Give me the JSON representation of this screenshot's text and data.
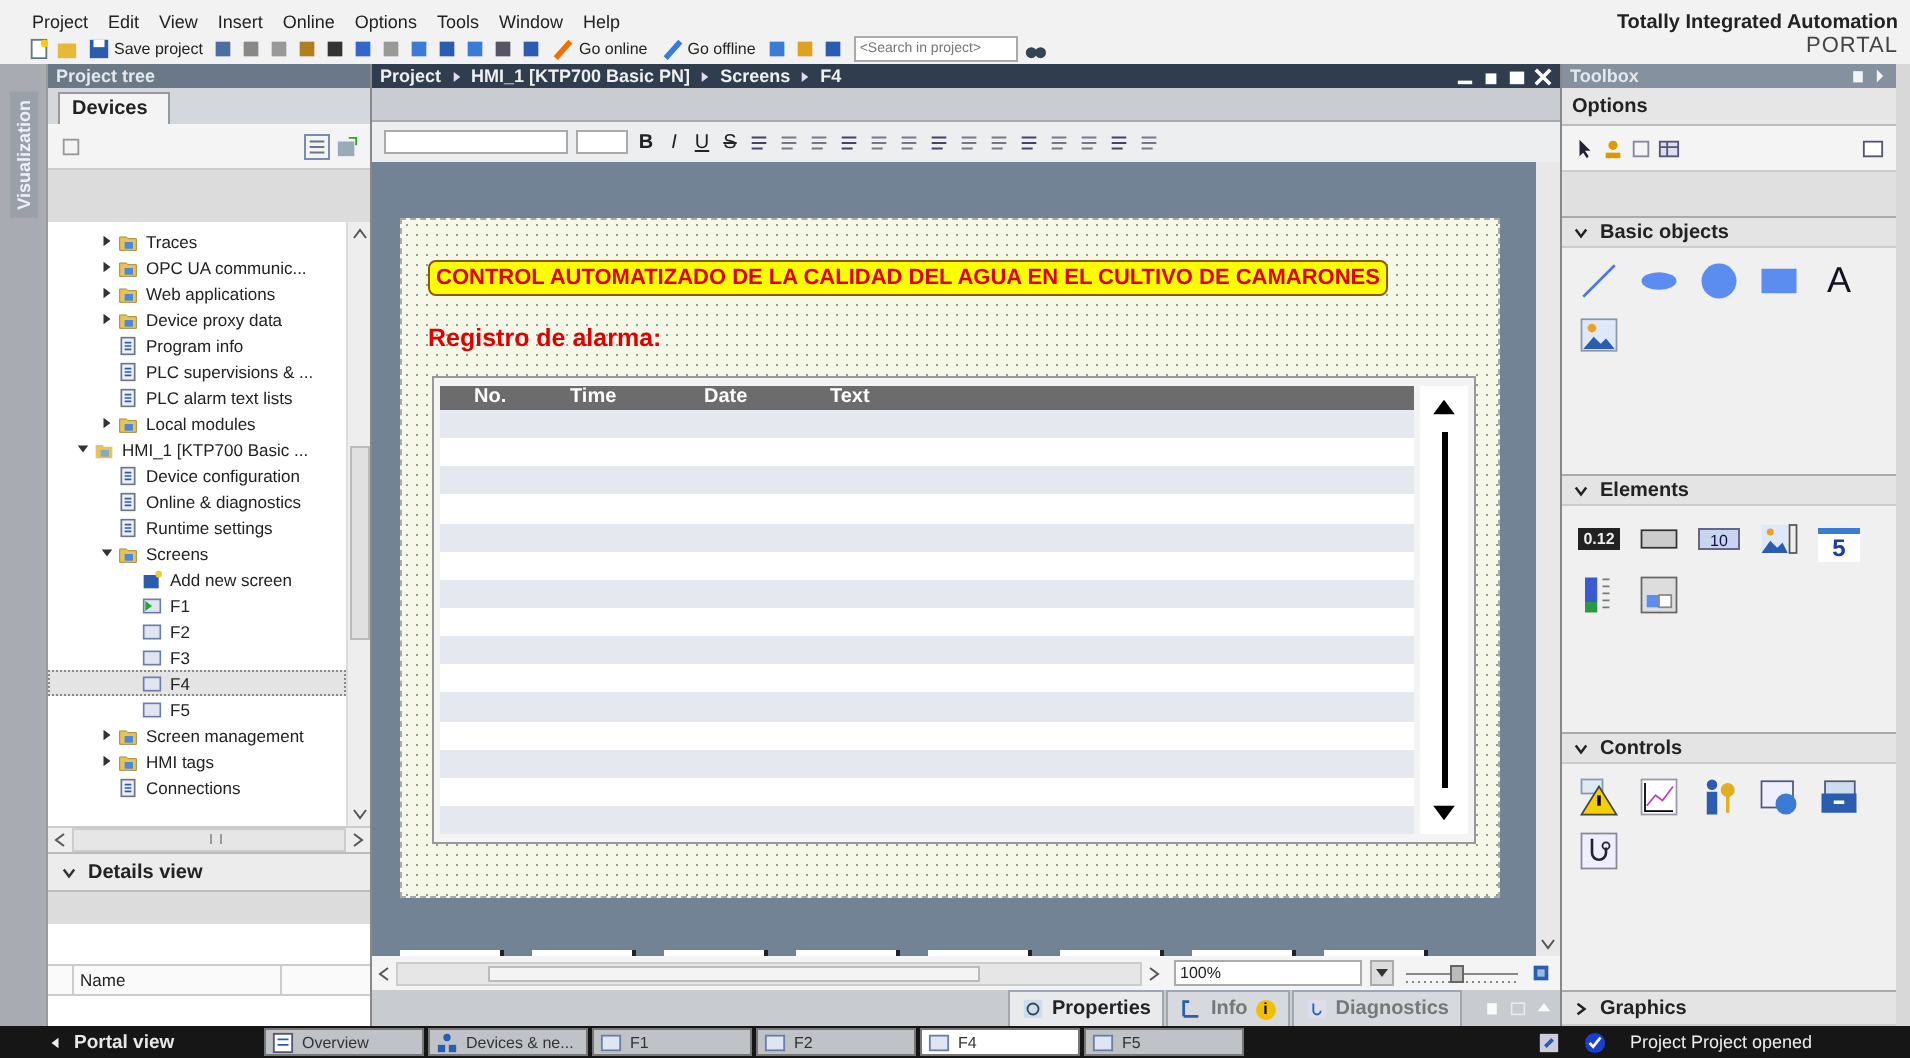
{
  "menu": [
    "Project",
    "Edit",
    "View",
    "Insert",
    "Online",
    "Options",
    "Tools",
    "Window",
    "Help"
  ],
  "toolbar": {
    "save": "Save project",
    "go_online": "Go online",
    "go_offline": "Go offline",
    "search_placeholder": "<Search in project>"
  },
  "brand": {
    "title": "Totally Integrated Automation",
    "subtitle": "PORTAL"
  },
  "side_tab": "Visualization",
  "project_tree": {
    "title": "Project tree",
    "tab": "Devices",
    "continued_children": [
      {
        "label": "Traces",
        "kind": "folder",
        "expanded": false,
        "selected": false
      },
      {
        "label": "OPC UA communic...",
        "kind": "folder",
        "expanded": false,
        "selected": false
      },
      {
        "label": "Web applications",
        "kind": "folder",
        "expanded": false,
        "selected": false
      },
      {
        "label": "Device proxy data",
        "kind": "folder",
        "expanded": false,
        "selected": false
      },
      {
        "label": "Program info",
        "kind": "item",
        "selected": false
      },
      {
        "label": "PLC supervisions & ...",
        "kind": "item",
        "selected": false
      },
      {
        "label": "PLC alarm text lists",
        "kind": "item",
        "selected": false
      },
      {
        "label": "Local modules",
        "kind": "folder",
        "expanded": false,
        "selected": false
      }
    ],
    "items": [
      {
        "label": "HMI_1 [KTP700 Basic ...",
        "kind": "device",
        "expanded": true,
        "selected": false,
        "children": [
          {
            "label": "Device configuration",
            "kind": "item",
            "selected": false
          },
          {
            "label": "Online & diagnostics",
            "kind": "item",
            "selected": false
          },
          {
            "label": "Runtime settings",
            "kind": "item",
            "selected": false
          },
          {
            "label": "Screens",
            "kind": "folder",
            "expanded": true,
            "selected": false,
            "children": [
              {
                "label": "Add new screen",
                "kind": "add",
                "selected": false
              },
              {
                "label": "F1",
                "kind": "start_screen",
                "selected": false
              },
              {
                "label": "F2",
                "kind": "screen",
                "selected": false
              },
              {
                "label": "F3",
                "kind": "screen",
                "selected": false
              },
              {
                "label": "F4",
                "kind": "screen",
                "selected": true
              },
              {
                "label": "F5",
                "kind": "screen",
                "selected": false
              }
            ]
          },
          {
            "label": "Screen management",
            "kind": "folder",
            "expanded": false,
            "selected": false
          },
          {
            "label": "HMI tags",
            "kind": "folder",
            "expanded": false,
            "selected": false
          },
          {
            "label": "Connections",
            "kind": "item",
            "selected": false
          }
        ]
      }
    ]
  },
  "details_view": {
    "title": "Details view",
    "expanded": true,
    "columns": [
      "Name"
    ]
  },
  "editor": {
    "breadcrumb": [
      "Project",
      "HMI_1 [KTP700 Basic PN]",
      "Screens",
      "F4"
    ],
    "format_buttons": [
      "B",
      "I",
      "U",
      "S"
    ],
    "screen": {
      "title": "CONTROL AUTOMATIZADO DE LA CALIDAD DEL AGUA EN EL CULTIVO DE CAMARONES",
      "subtitle": "Registro de alarma:",
      "alarm_view": {
        "columns": [
          "No.",
          "Time",
          "Date",
          "Text"
        ]
      }
    },
    "zoom": "100%",
    "zoom_slider": {
      "level": 0.45
    }
  },
  "inspector_tabs": [
    {
      "label": "Properties",
      "kind": "properties",
      "selected": true
    },
    {
      "label": "Info",
      "kind": "info",
      "selected": false,
      "badge": "i"
    },
    {
      "label": "Diagnostics",
      "kind": "diagnostics",
      "selected": false
    }
  ],
  "toolbox": {
    "title": "Toolbox",
    "options": "Options",
    "sections": [
      {
        "title": "Basic objects",
        "expanded": true,
        "tools": [
          {
            "kind": "line"
          },
          {
            "kind": "ellipse"
          },
          {
            "kind": "circle"
          },
          {
            "kind": "rectangle"
          },
          {
            "kind": "text",
            "label": "A"
          },
          {
            "kind": "image"
          }
        ]
      },
      {
        "title": "Elements",
        "expanded": true,
        "tools": [
          {
            "kind": "io",
            "label": "0.12"
          },
          {
            "kind": "button"
          },
          {
            "kind": "symbolic",
            "label": "10"
          },
          {
            "kind": "graphic_io"
          },
          {
            "kind": "datetime",
            "label": "5"
          },
          {
            "kind": "bar"
          },
          {
            "kind": "switch"
          }
        ]
      },
      {
        "title": "Controls",
        "expanded": true,
        "tools": [
          {
            "kind": "alarm"
          },
          {
            "kind": "trend"
          },
          {
            "kind": "user"
          },
          {
            "kind": "web"
          },
          {
            "kind": "recipe"
          },
          {
            "kind": "diagnostics"
          }
        ]
      },
      {
        "title": "Graphics",
        "expanded": false
      }
    ]
  },
  "taskbar": {
    "portal": "Portal view",
    "tabs": [
      {
        "label": "Overview",
        "kind": "overview",
        "selected": false
      },
      {
        "label": "Devices & ne...",
        "kind": "devices",
        "selected": false
      },
      {
        "label": "F1",
        "kind": "screen",
        "selected": false
      },
      {
        "label": "F2",
        "kind": "screen",
        "selected": false
      },
      {
        "label": "F4",
        "kind": "screen",
        "selected": true
      },
      {
        "label": "F5",
        "kind": "screen",
        "selected": false
      }
    ],
    "status": "Project Project opened"
  }
}
